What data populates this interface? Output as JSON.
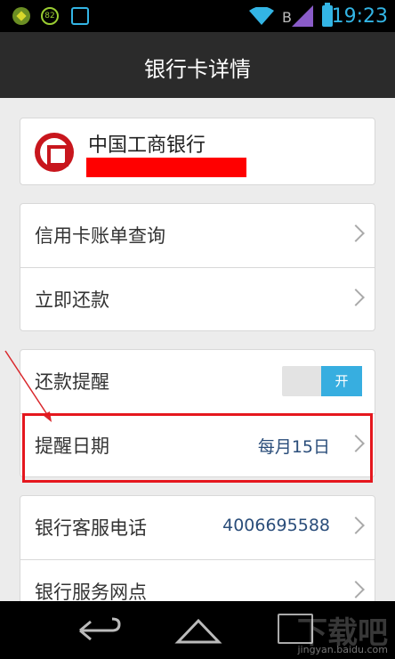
{
  "status_bar": {
    "badge_number": "82",
    "network_letter": "B",
    "time": "19:23"
  },
  "header": {
    "title": "银行卡详情"
  },
  "bank": {
    "name": "中国工商银行"
  },
  "sections": [
    {
      "rows": [
        {
          "label": "信用卡账单查询"
        },
        {
          "label": "立即还款"
        }
      ]
    },
    {
      "rows": [
        {
          "label": "还款提醒",
          "toggle_label": "开",
          "toggle_state": "on"
        },
        {
          "label": "提醒日期",
          "value": "每月15日"
        }
      ]
    },
    {
      "rows": [
        {
          "label": "银行客服电话",
          "value": "4006695588"
        },
        {
          "label": "银行服务网点"
        }
      ]
    }
  ],
  "watermark": {
    "main": "下载吧",
    "sub": "jingyan.baidu.com"
  },
  "colors": {
    "accent": "#37aee0",
    "highlight": "#e5171e",
    "bank_red": "#c8161d",
    "value_text": "#2a4d7a"
  },
  "icons": {
    "bank_logo": "icbc-logo-icon",
    "chevron": "chevron-right-icon",
    "back": "back-arrow-icon",
    "home": "home-icon",
    "recent": "recent-apps-icon"
  }
}
